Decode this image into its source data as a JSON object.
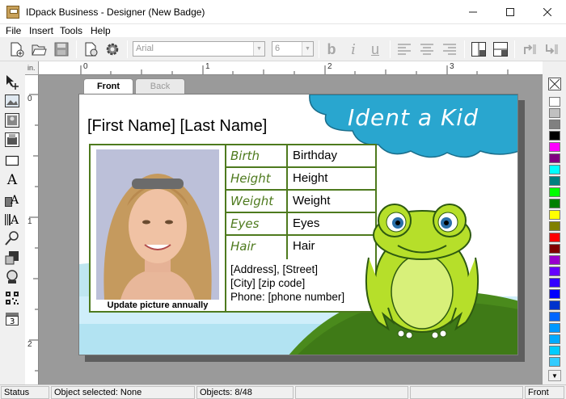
{
  "window": {
    "title": "IDpack Business - Designer (New Badge)"
  },
  "menu": [
    "File",
    "Insert",
    "Tools",
    "Help"
  ],
  "toolbar": {
    "font": "Arial",
    "size": "6"
  },
  "ruler": {
    "unit": "in.",
    "top": [
      "0",
      "1",
      "2",
      "3"
    ],
    "left": [
      "0",
      "1",
      "2"
    ]
  },
  "tabs": {
    "front": "Front",
    "back": "Back"
  },
  "badge": {
    "name": "[First Name] [Last Name]",
    "logo": "Ident a Kid",
    "photo_caption": "Update picture annually",
    "fields": [
      {
        "label": "Birth",
        "value": "Birthday"
      },
      {
        "label": "Height",
        "value": "Height"
      },
      {
        "label": "Weight",
        "value": "Weight"
      },
      {
        "label": "Eyes",
        "value": "Eyes"
      },
      {
        "label": "Hair",
        "value": "Hair"
      }
    ],
    "address": [
      "[Address], [Street]",
      "[City]  [zip code]",
      "Phone: [phone number]"
    ]
  },
  "status": {
    "label": "Status",
    "selected": "Object selected: None",
    "objects": "Objects: 8/48",
    "side": "Front"
  },
  "colors": {
    "accent_green": "#4e7a1e",
    "cloud_blue": "#27a3cb",
    "swatches": [
      "#ffffff",
      "#c0c0c0",
      "#808080",
      "#000000",
      "#ff00ff",
      "#800080",
      "#00ffff",
      "#008080",
      "#00ff00",
      "#008000",
      "#ffff00",
      "#808000",
      "#ff0000",
      "#800000",
      "#9900cc",
      "#6600ff",
      "#3300ff",
      "#0000ff",
      "#0033cc",
      "#0066ff",
      "#0099ff",
      "#00aaff",
      "#00ccff",
      "#33ccff"
    ]
  },
  "icons": {
    "toolbar": [
      "new-icon",
      "open-icon",
      "save-icon",
      "print-preview-icon",
      "settings-icon",
      "bold-icon",
      "italic-icon",
      "underline-icon",
      "align-left-icon",
      "align-center-icon",
      "align-right-icon",
      "add-icon",
      "remove-icon",
      "bring-forward-icon",
      "send-backward-icon"
    ],
    "left": [
      "pointer-icon",
      "image-icon",
      "photo-icon",
      "signature-icon",
      "rectangle-icon",
      "text-icon",
      "field-text-icon",
      "barcode-text-icon",
      "line-icon",
      "shape-icon",
      "zoom-icon",
      "qrcode-icon",
      "counter-icon"
    ]
  }
}
